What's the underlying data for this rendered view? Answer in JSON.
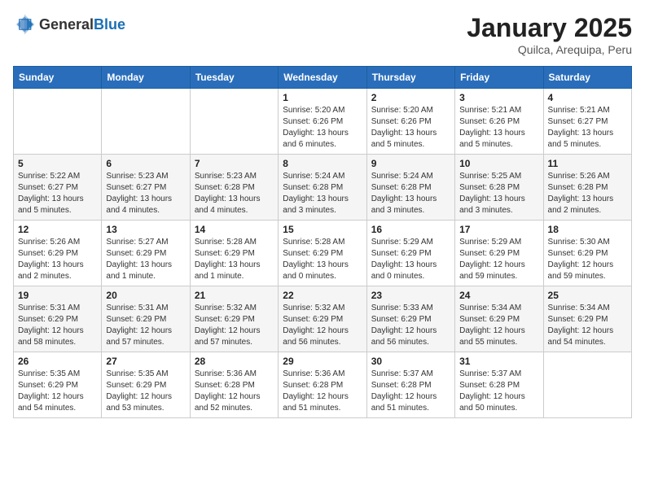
{
  "header": {
    "logo_general": "General",
    "logo_blue": "Blue",
    "title": "January 2025",
    "location": "Quilca, Arequipa, Peru"
  },
  "weekdays": [
    "Sunday",
    "Monday",
    "Tuesday",
    "Wednesday",
    "Thursday",
    "Friday",
    "Saturday"
  ],
  "weeks": [
    [
      {
        "day": "",
        "sunrise": "",
        "sunset": "",
        "daylight": ""
      },
      {
        "day": "",
        "sunrise": "",
        "sunset": "",
        "daylight": ""
      },
      {
        "day": "",
        "sunrise": "",
        "sunset": "",
        "daylight": ""
      },
      {
        "day": "1",
        "sunrise": "Sunrise: 5:20 AM",
        "sunset": "Sunset: 6:26 PM",
        "daylight": "Daylight: 13 hours and 6 minutes."
      },
      {
        "day": "2",
        "sunrise": "Sunrise: 5:20 AM",
        "sunset": "Sunset: 6:26 PM",
        "daylight": "Daylight: 13 hours and 5 minutes."
      },
      {
        "day": "3",
        "sunrise": "Sunrise: 5:21 AM",
        "sunset": "Sunset: 6:26 PM",
        "daylight": "Daylight: 13 hours and 5 minutes."
      },
      {
        "day": "4",
        "sunrise": "Sunrise: 5:21 AM",
        "sunset": "Sunset: 6:27 PM",
        "daylight": "Daylight: 13 hours and 5 minutes."
      }
    ],
    [
      {
        "day": "5",
        "sunrise": "Sunrise: 5:22 AM",
        "sunset": "Sunset: 6:27 PM",
        "daylight": "Daylight: 13 hours and 5 minutes."
      },
      {
        "day": "6",
        "sunrise": "Sunrise: 5:23 AM",
        "sunset": "Sunset: 6:27 PM",
        "daylight": "Daylight: 13 hours and 4 minutes."
      },
      {
        "day": "7",
        "sunrise": "Sunrise: 5:23 AM",
        "sunset": "Sunset: 6:28 PM",
        "daylight": "Daylight: 13 hours and 4 minutes."
      },
      {
        "day": "8",
        "sunrise": "Sunrise: 5:24 AM",
        "sunset": "Sunset: 6:28 PM",
        "daylight": "Daylight: 13 hours and 3 minutes."
      },
      {
        "day": "9",
        "sunrise": "Sunrise: 5:24 AM",
        "sunset": "Sunset: 6:28 PM",
        "daylight": "Daylight: 13 hours and 3 minutes."
      },
      {
        "day": "10",
        "sunrise": "Sunrise: 5:25 AM",
        "sunset": "Sunset: 6:28 PM",
        "daylight": "Daylight: 13 hours and 3 minutes."
      },
      {
        "day": "11",
        "sunrise": "Sunrise: 5:26 AM",
        "sunset": "Sunset: 6:28 PM",
        "daylight": "Daylight: 13 hours and 2 minutes."
      }
    ],
    [
      {
        "day": "12",
        "sunrise": "Sunrise: 5:26 AM",
        "sunset": "Sunset: 6:29 PM",
        "daylight": "Daylight: 13 hours and 2 minutes."
      },
      {
        "day": "13",
        "sunrise": "Sunrise: 5:27 AM",
        "sunset": "Sunset: 6:29 PM",
        "daylight": "Daylight: 13 hours and 1 minute."
      },
      {
        "day": "14",
        "sunrise": "Sunrise: 5:28 AM",
        "sunset": "Sunset: 6:29 PM",
        "daylight": "Daylight: 13 hours and 1 minute."
      },
      {
        "day": "15",
        "sunrise": "Sunrise: 5:28 AM",
        "sunset": "Sunset: 6:29 PM",
        "daylight": "Daylight: 13 hours and 0 minutes."
      },
      {
        "day": "16",
        "sunrise": "Sunrise: 5:29 AM",
        "sunset": "Sunset: 6:29 PM",
        "daylight": "Daylight: 13 hours and 0 minutes."
      },
      {
        "day": "17",
        "sunrise": "Sunrise: 5:29 AM",
        "sunset": "Sunset: 6:29 PM",
        "daylight": "Daylight: 12 hours and 59 minutes."
      },
      {
        "day": "18",
        "sunrise": "Sunrise: 5:30 AM",
        "sunset": "Sunset: 6:29 PM",
        "daylight": "Daylight: 12 hours and 59 minutes."
      }
    ],
    [
      {
        "day": "19",
        "sunrise": "Sunrise: 5:31 AM",
        "sunset": "Sunset: 6:29 PM",
        "daylight": "Daylight: 12 hours and 58 minutes."
      },
      {
        "day": "20",
        "sunrise": "Sunrise: 5:31 AM",
        "sunset": "Sunset: 6:29 PM",
        "daylight": "Daylight: 12 hours and 57 minutes."
      },
      {
        "day": "21",
        "sunrise": "Sunrise: 5:32 AM",
        "sunset": "Sunset: 6:29 PM",
        "daylight": "Daylight: 12 hours and 57 minutes."
      },
      {
        "day": "22",
        "sunrise": "Sunrise: 5:32 AM",
        "sunset": "Sunset: 6:29 PM",
        "daylight": "Daylight: 12 hours and 56 minutes."
      },
      {
        "day": "23",
        "sunrise": "Sunrise: 5:33 AM",
        "sunset": "Sunset: 6:29 PM",
        "daylight": "Daylight: 12 hours and 56 minutes."
      },
      {
        "day": "24",
        "sunrise": "Sunrise: 5:34 AM",
        "sunset": "Sunset: 6:29 PM",
        "daylight": "Daylight: 12 hours and 55 minutes."
      },
      {
        "day": "25",
        "sunrise": "Sunrise: 5:34 AM",
        "sunset": "Sunset: 6:29 PM",
        "daylight": "Daylight: 12 hours and 54 minutes."
      }
    ],
    [
      {
        "day": "26",
        "sunrise": "Sunrise: 5:35 AM",
        "sunset": "Sunset: 6:29 PM",
        "daylight": "Daylight: 12 hours and 54 minutes."
      },
      {
        "day": "27",
        "sunrise": "Sunrise: 5:35 AM",
        "sunset": "Sunset: 6:29 PM",
        "daylight": "Daylight: 12 hours and 53 minutes."
      },
      {
        "day": "28",
        "sunrise": "Sunrise: 5:36 AM",
        "sunset": "Sunset: 6:28 PM",
        "daylight": "Daylight: 12 hours and 52 minutes."
      },
      {
        "day": "29",
        "sunrise": "Sunrise: 5:36 AM",
        "sunset": "Sunset: 6:28 PM",
        "daylight": "Daylight: 12 hours and 51 minutes."
      },
      {
        "day": "30",
        "sunrise": "Sunrise: 5:37 AM",
        "sunset": "Sunset: 6:28 PM",
        "daylight": "Daylight: 12 hours and 51 minutes."
      },
      {
        "day": "31",
        "sunrise": "Sunrise: 5:37 AM",
        "sunset": "Sunset: 6:28 PM",
        "daylight": "Daylight: 12 hours and 50 minutes."
      },
      {
        "day": "",
        "sunrise": "",
        "sunset": "",
        "daylight": ""
      }
    ]
  ]
}
